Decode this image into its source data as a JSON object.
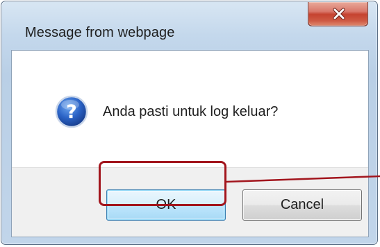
{
  "dialog": {
    "title": "Message from webpage",
    "close_icon": "close-icon",
    "close_button_color": "#c5422f"
  },
  "message": {
    "icon": "question-icon",
    "text": "Anda pasti untuk log keluar?"
  },
  "buttons": {
    "ok_label": "OK",
    "cancel_label": "Cancel"
  },
  "annotation": {
    "highlight_target": "ok-button",
    "color": "#a2151d"
  }
}
